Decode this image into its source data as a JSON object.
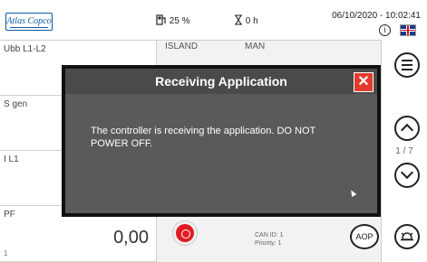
{
  "header": {
    "logo_text": "Atlas Copco",
    "fuel_level": "25 %",
    "run_hours": "0 h",
    "datetime": "06/10/2020 - 10:02:41",
    "info_glyph": "i"
  },
  "panels": [
    {
      "label": "Ubb L1-L2",
      "value": "",
      "small": ""
    },
    {
      "label": "S gen",
      "value": "",
      "small": ""
    },
    {
      "label": "I L1",
      "value": "",
      "small": ""
    },
    {
      "label": "PF",
      "value": "0,00",
      "small": "1"
    }
  ],
  "mid_header": {
    "left": "ISLAND",
    "right": "MAN"
  },
  "pager": {
    "indicator": "1 / 7"
  },
  "bottom": {
    "can_id": "CAN ID: 1",
    "priority": "Priority: 1",
    "aop_label": "AOP"
  },
  "dialog": {
    "title": "Receiving Application",
    "close_glyph": "✕",
    "message": "The controller is receiving the application. DO NOT POWER OFF."
  },
  "icons": {
    "fuel": "fuel-icon",
    "hourglass": "hourglass-icon",
    "info": "info-icon",
    "flag": "uk-flag-icon",
    "menu": "menu-icon",
    "up": "chevron-up-icon",
    "down": "chevron-down-icon",
    "stop": "stop-button-icon",
    "alarm": "alarm-bell-icon"
  },
  "colors": {
    "brand": "#0b5aa5",
    "dialog_bg": "#5a5a5a",
    "close_red": "#e23b2e",
    "stop_red": "#e21b23"
  }
}
